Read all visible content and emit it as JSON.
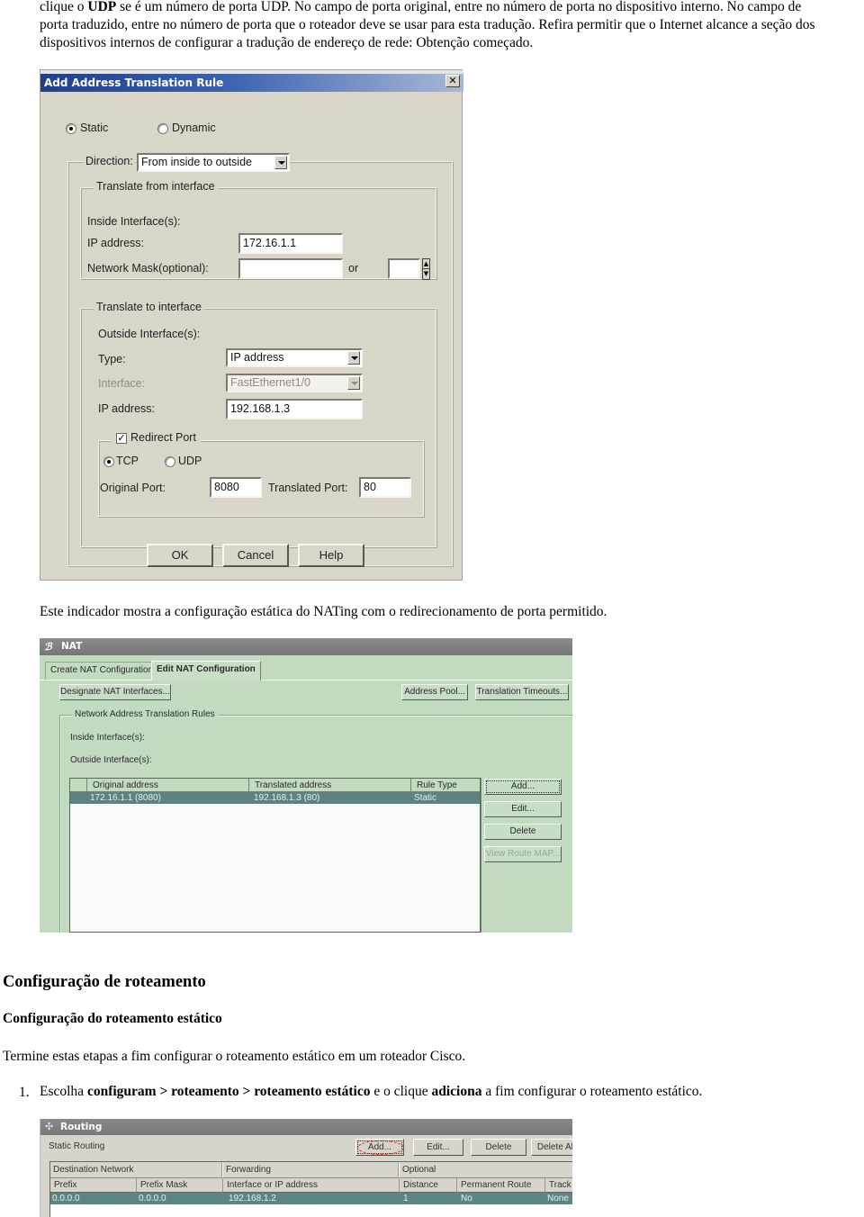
{
  "intro_paragraph": {
    "t1": "clique o ",
    "b1": "UDP",
    "t2": " se é um número de porta UDP. No campo de porta original, entre no número de porta no dispositivo interno. No campo de",
    "line2": "porta traduzido, entre no número de porta que o roteador deve se usar para esta tradução. Refira permitir que o Internet alcance a seção dos",
    "line3": "dispositivos internos de configurar a tradução de endereço de rede: Obtenção começado."
  },
  "dialog": {
    "title": "Add Address Translation Rule",
    "close_icon": "close-icon",
    "mode_options": [
      {
        "label": "Static",
        "selected": true
      },
      {
        "label": "Dynamic",
        "selected": false
      }
    ],
    "direction_label": "Direction:",
    "direction_value": "From inside to outside",
    "translate_from": {
      "group_title": "Translate from interface",
      "inside_interfaces_label": "Inside Interface(s):",
      "ip_address_label": "IP address:",
      "ip_address_value": "172.16.1.1",
      "network_mask_label": "Network Mask(optional):",
      "network_mask_value": "",
      "or_label": "or",
      "prefix_value": ""
    },
    "translate_to": {
      "group_title": "Translate to interface",
      "outside_interfaces_label": "Outside Interface(s):",
      "type_label": "Type:",
      "type_value": "IP address",
      "interface_label": "Interface:",
      "interface_value": "FastEthernet1/0",
      "ip_address_label": "IP address:",
      "ip_address_value": "192.168.1.3"
    },
    "redirect_port": {
      "label": "Redirect Port",
      "checked": true,
      "protocols": [
        {
          "label": "TCP",
          "selected": true
        },
        {
          "label": "UDP",
          "selected": false
        }
      ],
      "original_port_label": "Original Port:",
      "original_port_value": "8080",
      "translated_port_label": "Translated Port:",
      "translated_port_value": "80"
    },
    "buttons": {
      "ok": "OK",
      "cancel": "Cancel",
      "help": "Help"
    }
  },
  "caption_nat": "Este indicador mostra a configuração estática do NATing com o redirecionamento de porta permitido.",
  "nat_panel": {
    "title": "NAT",
    "tabs": [
      {
        "label": "Create NAT Configuration",
        "active": false
      },
      {
        "label": "Edit NAT Configuration",
        "active": true
      }
    ],
    "designate_button": "Designate NAT Interfaces...",
    "address_pool_button": "Address Pool...",
    "translation_timeouts_button": "Translation Timeouts...",
    "group_title": "Network Address Translation Rules",
    "inside_interfaces_label": "Inside Interface(s):",
    "outside_interfaces_label": "Outside Interface(s):",
    "table": {
      "columns": [
        "Original address",
        "Translated address",
        "Rule Type"
      ],
      "rows": [
        [
          "172.16.1.1 (8080)",
          "192.168.1.3 (80)",
          "Static"
        ]
      ]
    },
    "side_buttons": {
      "add": "Add...",
      "edit": "Edit...",
      "delete": "Delete",
      "view_route_map": "View Route MAP..."
    }
  },
  "section_heading": "Configuração de roteamento",
  "subsection_heading": "Configuração do roteamento estático",
  "steps_intro": "Termine estas etapas a fim configurar o roteamento estático em um roteador Cisco.",
  "step1": {
    "number": "1.",
    "t1": "Escolha ",
    "b1": "configuram > roteamento > roteamento estático",
    "t2": " e o clique ",
    "b2": "adiciona",
    "t3": " a fim configurar o roteamento estático."
  },
  "routing_panel": {
    "title": "Routing",
    "section_label": "Static Routing",
    "buttons": {
      "add": "Add...",
      "edit": "Edit...",
      "delete": "Delete",
      "delete_all": "Delete All"
    },
    "group_headers": [
      "Destination Network",
      "Forwarding",
      "Optional"
    ],
    "columns": [
      "Prefix",
      "Prefix Mask",
      "Interface or IP address",
      "Distance",
      "Permanent Route",
      "Track I"
    ],
    "rows": [
      [
        "0.0.0.0",
        "0.0.0.0",
        "192.168.1.2",
        "1",
        "No",
        "None"
      ]
    ]
  },
  "colors": {
    "dialog_title_bar": "#1e3f8c",
    "nat_panel_bg": "#c2dac0",
    "selected_row": "#5e8282",
    "highlight_circle": "#d02020"
  }
}
